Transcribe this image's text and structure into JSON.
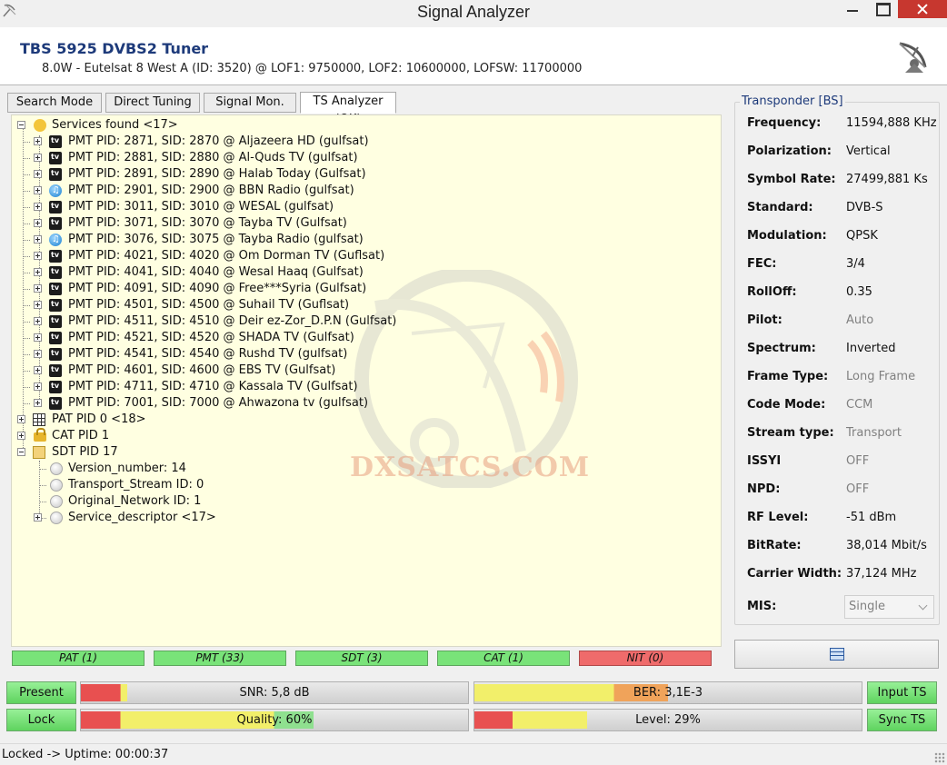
{
  "window": {
    "title": "Signal Analyzer"
  },
  "header": {
    "device_name": "TBS 5925 DVBS2 Tuner",
    "device_info": "8.0W - Eutelsat 8 West A (ID: 3520) @ LOF1: 9750000, LOF2: 10600000, LOFSW: 11700000"
  },
  "tabs": [
    {
      "label": "Search Mode",
      "active": false
    },
    {
      "label": "Direct Tuning",
      "active": false
    },
    {
      "label": "Signal Mon.",
      "active": false
    },
    {
      "label": "TS Analyzer (OK)",
      "active": true
    }
  ],
  "tree": {
    "services_root": "Services found <17>",
    "services": [
      {
        "label": "PMT PID: 2871, SID: 2870 @ Aljazeera HD (gulfsat)",
        "icon": "tv-icon"
      },
      {
        "label": "PMT PID: 2881, SID: 2880 @ Al-Quds TV (gulfsat)",
        "icon": "tv-icon"
      },
      {
        "label": "PMT PID: 2891, SID: 2890 @ Halab Today (Gulfsat)",
        "icon": "tv-icon"
      },
      {
        "label": "PMT PID: 2901, SID: 2900 @ BBN Radio (gulfsat)",
        "icon": "radio-icon"
      },
      {
        "label": "PMT PID: 3011, SID: 3010 @ WESAL (gulfsat)",
        "icon": "tv-icon"
      },
      {
        "label": "PMT PID: 3071, SID: 3070 @ Tayba TV (Gulfsat)",
        "icon": "tv-icon"
      },
      {
        "label": "PMT PID: 3076, SID: 3075 @ Tayba Radio (gulfsat)",
        "icon": "radio-icon"
      },
      {
        "label": "PMT PID: 4021, SID: 4020 @ Om Dorman TV (Guflsat)",
        "icon": "tv-icon"
      },
      {
        "label": "PMT PID: 4041, SID: 4040 @ Wesal Haaq (Gulfsat)",
        "icon": "tv-icon"
      },
      {
        "label": "PMT PID: 4091, SID: 4090 @ Free***Syria (Gulfsat)",
        "icon": "tv-icon"
      },
      {
        "label": "PMT PID: 4501, SID: 4500 @ Suhail TV (Guflsat)",
        "icon": "tv-icon"
      },
      {
        "label": "PMT PID: 4511, SID: 4510 @ Deir ez-Zor_D.P.N (Gulfsat)",
        "icon": "tv-icon"
      },
      {
        "label": "PMT PID: 4521, SID: 4520 @ SHADA TV (Gulfsat)",
        "icon": "tv-icon"
      },
      {
        "label": "PMT PID: 4541, SID: 4540 @ Rushd TV (gulfsat)",
        "icon": "tv-icon"
      },
      {
        "label": "PMT PID: 4601, SID: 4600 @ EBS TV (Gulfsat)",
        "icon": "tv-icon"
      },
      {
        "label": "PMT PID: 4711, SID: 4710 @ Kassala TV (Gulfsat)",
        "icon": "tv-icon"
      },
      {
        "label": "PMT PID: 7001, SID: 7000 @ Ahwazona tv (gulfsat)",
        "icon": "tv-icon"
      }
    ],
    "pat": "PAT PID 0 <18>",
    "cat": "CAT PID 1",
    "sdt": "SDT PID 17",
    "sdt_children": [
      "Version_number: 14",
      "Transport_Stream ID: 0",
      "Original_Network ID: 1",
      "Service_descriptor <17>"
    ]
  },
  "watermark": "DXSATCS.COM",
  "tables": [
    {
      "label": "PAT (1)",
      "status": "ok"
    },
    {
      "label": "PMT (33)",
      "status": "ok"
    },
    {
      "label": "SDT (3)",
      "status": "ok"
    },
    {
      "label": "CAT (1)",
      "status": "ok"
    },
    {
      "label": "NIT (0)",
      "status": "error"
    }
  ],
  "transponder": {
    "title": "Transponder [BS]",
    "fields": [
      {
        "key": "Frequency:",
        "value": "11594,888 KHz",
        "muted": false
      },
      {
        "key": "Polarization:",
        "value": "Vertical",
        "muted": false
      },
      {
        "key": "Symbol Rate:",
        "value": "27499,881 Ks",
        "muted": false
      },
      {
        "key": "Standard:",
        "value": "DVB-S",
        "muted": false
      },
      {
        "key": "Modulation:",
        "value": "QPSK",
        "muted": false
      },
      {
        "key": "FEC:",
        "value": "3/4",
        "muted": false
      },
      {
        "key": "RollOff:",
        "value": "0.35",
        "muted": false
      },
      {
        "key": "Pilot:",
        "value": "Auto",
        "muted": true
      },
      {
        "key": "Spectrum:",
        "value": "Inverted",
        "muted": false
      },
      {
        "key": "Frame Type:",
        "value": "Long Frame",
        "muted": true
      },
      {
        "key": "Code Mode:",
        "value": "CCM",
        "muted": true
      },
      {
        "key": "Stream type:",
        "value": "Transport",
        "muted": true
      },
      {
        "key": "ISSYI",
        "value": "OFF",
        "muted": true
      },
      {
        "key": "NPD:",
        "value": "OFF",
        "muted": true
      },
      {
        "key": "RF Level:",
        "value": "-51 dBm",
        "muted": false
      },
      {
        "key": "BitRate:",
        "value": "38,014 Mbit/s",
        "muted": false
      },
      {
        "key": "Carrier Width:",
        "value": "37,124 MHz",
        "muted": false
      }
    ],
    "mis_label": "MIS:",
    "mis_value": "Single"
  },
  "status": {
    "present_label": "Present",
    "lock_label": "Lock",
    "input_ts_label": "Input TS",
    "sync_ts_label": "Sync TS",
    "snr_label": "SNR: 5,8 dB",
    "snr_fraction": 0.12,
    "ber_label": "BER: 3,1E-3",
    "ber_fraction": 0.5,
    "quality_label": "Quality: 60%",
    "quality_fraction": 0.6,
    "level_label": "Level: 29%",
    "level_fraction": 0.29
  },
  "statusbar": {
    "text": "Locked -> Uptime: 00:00:37"
  },
  "colors": {
    "accent": "#1d3a7a",
    "ok_green": "#79e379",
    "error_red": "#ef6b6b",
    "meter_red": "#e85050",
    "meter_yellow": "#f2ef6a",
    "meter_orange": "#f0a35a",
    "meter_green": "#8fe08f",
    "tree_bg": "#ffffe1"
  }
}
